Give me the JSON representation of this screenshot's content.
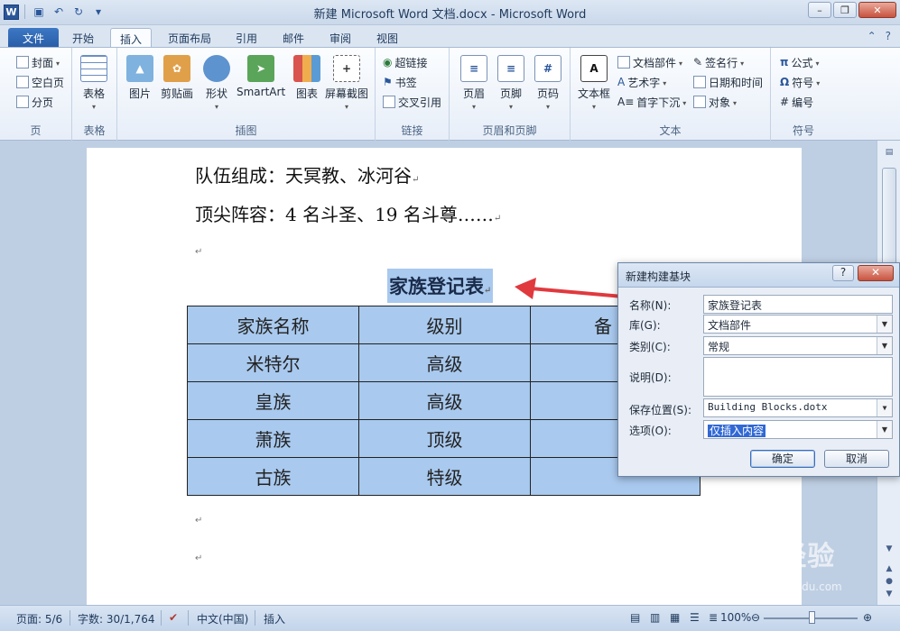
{
  "window": {
    "title": "新建 Microsoft Word 文档.docx - Microsoft Word",
    "app_logo": "W"
  },
  "tabs": [
    "文件",
    "开始",
    "插入",
    "页面布局",
    "引用",
    "邮件",
    "审阅",
    "视图"
  ],
  "active_tab": "插入",
  "ribbon": {
    "pages": {
      "label": "页",
      "items": [
        "封面",
        "空白页",
        "分页"
      ]
    },
    "tables": {
      "label": "表格",
      "items": [
        "表格"
      ]
    },
    "illustrations": {
      "label": "插图",
      "items": [
        "图片",
        "剪贴画",
        "形状",
        "SmartArt",
        "图表",
        "屏幕截图"
      ]
    },
    "links": {
      "label": "链接",
      "items": [
        "超链接",
        "书签",
        "交叉引用"
      ]
    },
    "header_footer": {
      "label": "页眉和页脚",
      "items": [
        "页眉",
        "页脚",
        "页码"
      ]
    },
    "text": {
      "label": "文本",
      "items": [
        "文本框",
        "文档部件",
        "艺术字",
        "首字下沉",
        "签名行",
        "日期和时间",
        "对象"
      ]
    },
    "symbols": {
      "label": "符号",
      "items": [
        "公式",
        "符号",
        "编号"
      ]
    }
  },
  "document": {
    "line1": "队伍组成：天冥教、冰河谷",
    "line2": "顶尖阵容：4 名斗圣、19 名斗尊……",
    "para_mark": "↵",
    "heading": "家族登记表",
    "table": {
      "rows": [
        [
          "家族名称",
          "级别",
          "备"
        ],
        [
          "米特尔",
          "高级",
          ""
        ],
        [
          "皇族",
          "高级",
          ""
        ],
        [
          "萧族",
          "顶级",
          ""
        ],
        [
          "古族",
          "特级",
          ""
        ]
      ]
    }
  },
  "dialog": {
    "title": "新建构建基块",
    "help_label": "?",
    "close_label": "✕",
    "fields": {
      "name": {
        "label": "名称(N):",
        "value": "家族登记表"
      },
      "gallery": {
        "label": "库(G):",
        "value": "文档部件"
      },
      "category": {
        "label": "类别(C):",
        "value": "常规"
      },
      "description": {
        "label": "说明(D):",
        "value": ""
      },
      "save_in": {
        "label": "保存位置(S):",
        "value": "Building Blocks.dotx"
      },
      "options": {
        "label": "选项(O):",
        "value": "仅插入内容"
      }
    },
    "ok_label": "确定",
    "cancel_label": "取消"
  },
  "statusbar": {
    "page": "页面: 5/6",
    "words": "字数: 30/1,764",
    "language": "中文(中国)",
    "mode": "插入",
    "zoom": "100%"
  },
  "watermark": {
    "text": "Baidu经验",
    "sub": "jingyan.baidu.com"
  },
  "colors": {
    "accent": "#2b579a",
    "selection": "#a9c9ee",
    "arrow": "#e0393e"
  }
}
